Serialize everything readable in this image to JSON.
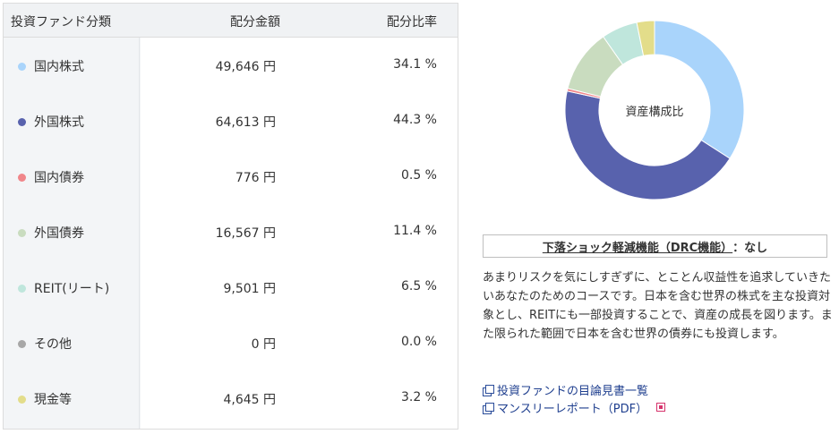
{
  "table": {
    "headers": {
      "name": "投資ファンド分類",
      "amount": "配分金額",
      "ratio": "配分比率"
    },
    "rows": [
      {
        "name": "国内株式",
        "amount": "49,646 円",
        "ratio": "34.1 %",
        "color": "#a9d4fb"
      },
      {
        "name": "外国株式",
        "amount": "64,613 円",
        "ratio": "44.3 %",
        "color": "#5862ad"
      },
      {
        "name": "国内債券",
        "amount": "776 円",
        "ratio": "0.5 %",
        "color": "#f0868a"
      },
      {
        "name": "外国債券",
        "amount": "16,567 円",
        "ratio": "11.4 %",
        "color": "#c9dcbf"
      },
      {
        "name": "REIT(リート)",
        "amount": "9,501 円",
        "ratio": "6.5 %",
        "color": "#bfe6dc"
      },
      {
        "name": "その他",
        "amount": "0 円",
        "ratio": "0.0 %",
        "color": "#a7a7a7"
      },
      {
        "name": "現金等",
        "amount": "4,645 円",
        "ratio": "3.2 %",
        "color": "#e3dd8a"
      }
    ]
  },
  "chart_data": {
    "type": "pie",
    "center_label": "資産構成比",
    "categories": [
      "国内株式",
      "外国株式",
      "国内債券",
      "外国債券",
      "REIT(リート)",
      "その他",
      "現金等"
    ],
    "values": [
      34.1,
      44.3,
      0.5,
      11.4,
      6.5,
      0.0,
      3.2
    ],
    "colors": [
      "#a9d4fb",
      "#5862ad",
      "#f0868a",
      "#c9dcbf",
      "#bfe6dc",
      "#a7a7a7",
      "#e3dd8a"
    ]
  },
  "drc": {
    "label": "下落ショック軽減機能（DRC機能）",
    "value": "：なし"
  },
  "description": "あまりリスクを気にしすぎずに、とことん収益性を追求していきたいあなたのためのコースです。日本を含む世界の株式を主な投資対象とし、REITにも一部投資することで、資産の成長を図ります。また限られた範囲で日本を含む世界の債券にも投資します。",
  "links": {
    "prospectus": "投資ファンドの目論見書一覧",
    "monthly_report": "マンスリーレポート（PDF）"
  }
}
